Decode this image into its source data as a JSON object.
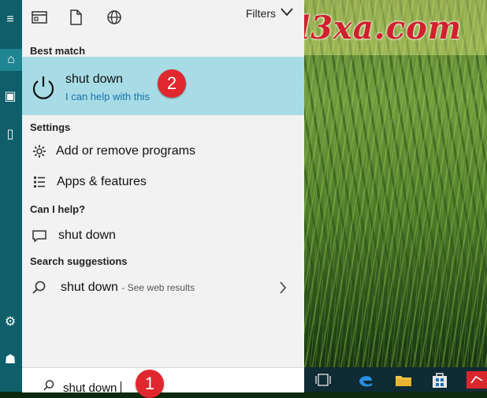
{
  "watermark": "l3xa.com",
  "filters_label": "Filters",
  "best_match": {
    "heading": "Best match",
    "title": "shut down",
    "subtitle": "I can help with this",
    "badge": "2"
  },
  "settings": {
    "heading": "Settings",
    "items": [
      {
        "label": "Add or remove programs",
        "icon": "gear-icon"
      },
      {
        "label": "Apps & features",
        "icon": "list-icon"
      }
    ]
  },
  "help": {
    "heading": "Can I help?",
    "items": [
      {
        "label": "shut down",
        "icon": "chat-icon"
      }
    ]
  },
  "suggestions": {
    "heading": "Search suggestions",
    "items": [
      {
        "label": "shut down",
        "suffix": "- See web results",
        "icon": "search-icon"
      }
    ]
  },
  "search": {
    "value": "shut down",
    "badge": "1"
  },
  "colors": {
    "rail": "#0e5f6a",
    "highlight": "#a7dce6",
    "badge": "#e0272e",
    "link": "#1a6fa8"
  }
}
